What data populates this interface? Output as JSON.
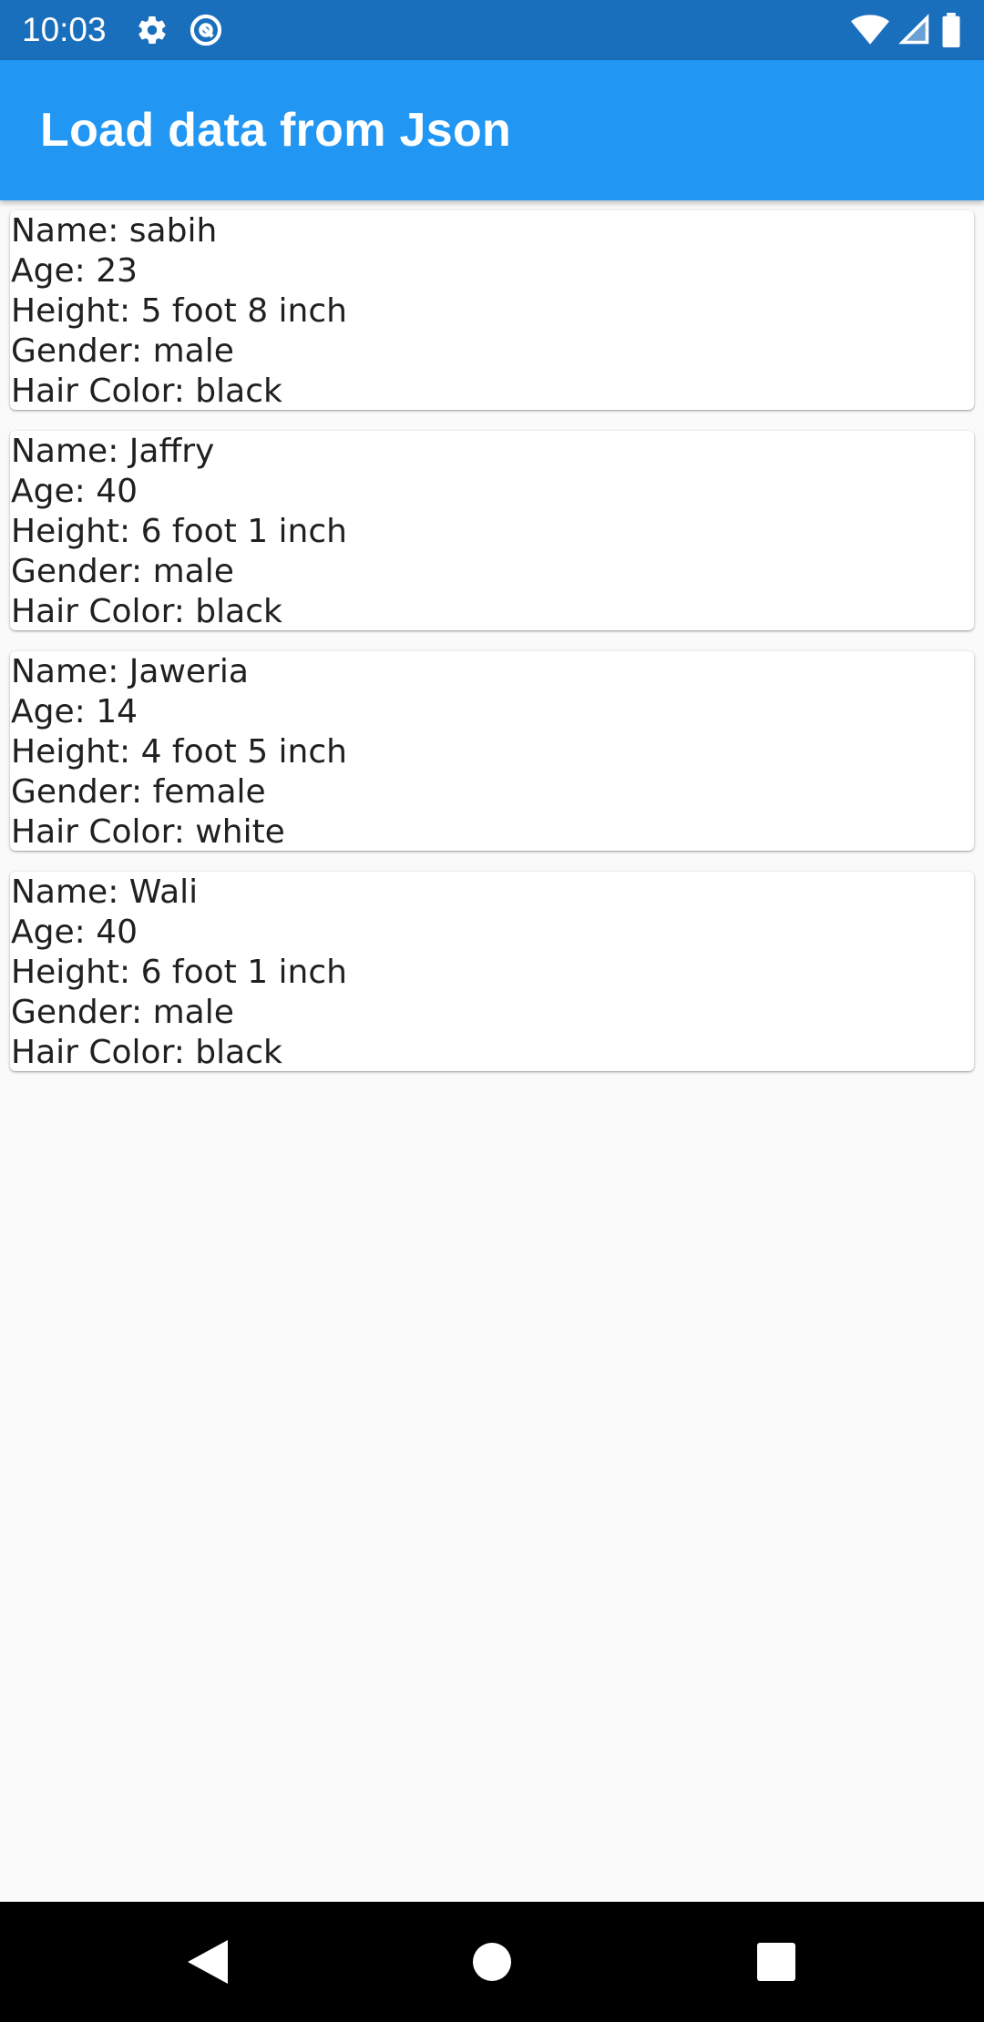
{
  "status_bar": {
    "time": "10:03",
    "icons_left": [
      "settings-icon",
      "at-sign-icon"
    ],
    "icons_right": [
      "wifi-icon",
      "cell-signal-icon",
      "battery-icon"
    ]
  },
  "app_bar": {
    "title": "Load data from Json",
    "color": "#2196f3"
  },
  "people": [
    {
      "name": "Name: sabih",
      "age": "Age: 23",
      "height": "Height: 5 foot 8 inch",
      "gender": "Gender: male",
      "hair": "Hair Color: black"
    },
    {
      "name": "Name: Jaffry",
      "age": "Age: 40",
      "height": "Height: 6 foot 1 inch",
      "gender": "Gender: male",
      "hair": "Hair Color: black"
    },
    {
      "name": "Name: Jaweria",
      "age": "Age: 14",
      "height": "Height: 4 foot 5 inch",
      "gender": "Gender: female",
      "hair": "Hair Color: white"
    },
    {
      "name": "Name: Wali",
      "age": "Age: 40",
      "height": "Height: 6 foot 1 inch",
      "gender": "Gender: male",
      "hair": "Hair Color: black"
    }
  ],
  "nav_bar": {
    "buttons": [
      "back-icon",
      "home-icon",
      "recents-icon"
    ]
  }
}
